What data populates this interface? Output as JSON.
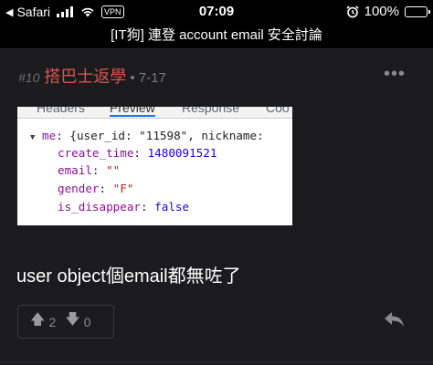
{
  "status_bar": {
    "back_label": "Safari",
    "vpn_label": "VPN",
    "time": "07:09",
    "battery_percent": "100%",
    "battery_level": 1.0,
    "icons": [
      "back-triangle-icon",
      "signal-icon",
      "wifi-icon",
      "alarm-icon",
      "battery-icon"
    ]
  },
  "page": {
    "title": "[IT狗] 連登 account email 安全討論"
  },
  "post": {
    "number": "#10",
    "author": "搭巴士返學",
    "date": "• 7-17",
    "body": "user object個email都無咗了",
    "upvotes": "2",
    "downvotes": "0",
    "colors": {
      "author": "#d9534f",
      "background": "#1b1b1d"
    }
  },
  "devtools": {
    "tabs": [
      "Headers",
      "Preview",
      "Response",
      "Coo"
    ],
    "active_tab": "Preview",
    "root_key": "me",
    "root_preview": "{user_id: \"11598\", nickname:",
    "fields": [
      {
        "key": "create_time",
        "value": "1480091521"
      },
      {
        "key": "email",
        "value": "\"\""
      },
      {
        "key": "gender",
        "value": "\"F\""
      },
      {
        "key": "is_disappear",
        "value": "false"
      }
    ]
  }
}
